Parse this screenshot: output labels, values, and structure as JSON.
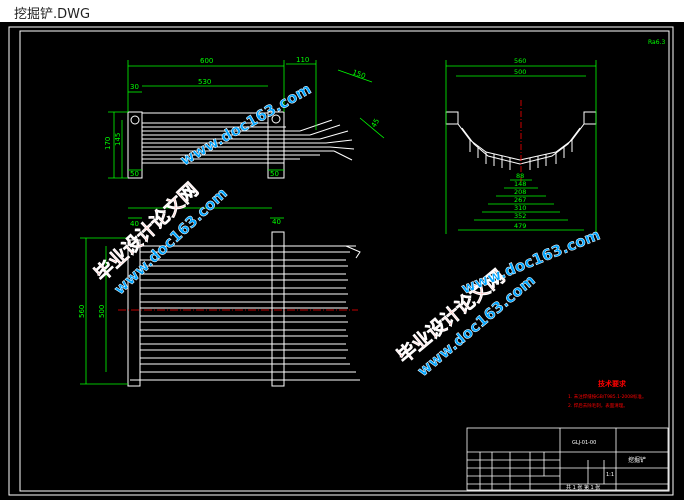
{
  "window": {
    "title": "挖掘铲.DWG"
  },
  "colors": {
    "background": "#000000",
    "frame": "#ffffff",
    "dimension": "#00ff00",
    "centerline": "#ff0000",
    "notes": "#ff0000",
    "watermark": "#ff2a2a",
    "watermark_url": "#00a5ff"
  },
  "drawing": {
    "corner_tag": "Ra6.3",
    "top_view_dims": {
      "overall": "600",
      "inner": "530",
      "left": "30",
      "extension": "110",
      "teeth_len": "150",
      "angle": "45",
      "height": "170",
      "height_inner": "145",
      "foot_left": "50",
      "foot_right": "50"
    },
    "side_view_dims": {
      "overall": "560",
      "inner": "500",
      "d1": "88",
      "d2": "148",
      "d3": "208",
      "d4": "267",
      "d5": "310",
      "d6": "352",
      "d7": "479"
    },
    "front_view_dims": {
      "left_offset": "40",
      "right_offset": "40",
      "height_outer": "560",
      "height_inner": "500"
    },
    "notes_title": "技术要求",
    "notes": [
      "1. 未注焊缝按GB/T985.1-2008标准。",
      "2. 焊后去除毛刺，表面清理。"
    ],
    "title_block": {
      "drawing_no": "GLJ-01-00",
      "name": "挖掘铲",
      "scale": "1:1",
      "sheet": "共 1 张 第 1 张"
    }
  },
  "watermarks": [
    {
      "text": "毕业设计论文网"
    },
    {
      "text": "www.doc163.com"
    }
  ]
}
